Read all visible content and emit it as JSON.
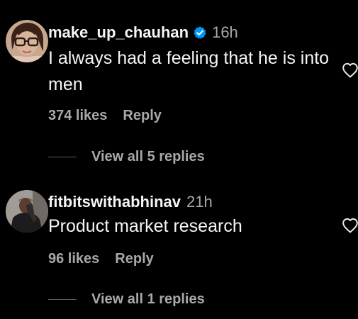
{
  "comments": [
    {
      "username": "make_up_chauhan",
      "verified": true,
      "time": "16h",
      "text": "I always had a feeling that he is into men",
      "likes": "374 likes",
      "reply_label": "Reply",
      "view_replies": "View all 5 replies",
      "avatar": "woman-with-glasses-avatar"
    },
    {
      "username": "fitbitswithabhinav",
      "verified": false,
      "time": "21h",
      "text": "Product market research",
      "likes": "96 likes",
      "reply_label": "Reply",
      "view_replies": "View all 1 replies",
      "avatar": "man-selfie-avatar"
    }
  ],
  "colors": {
    "background": "#000000",
    "primary_text": "#f5f5f5",
    "secondary_text": "#a8a8a8",
    "verified_badge": "#0095f6"
  },
  "icons": {
    "verified": "verified-badge-icon",
    "like": "heart-outline-icon"
  }
}
